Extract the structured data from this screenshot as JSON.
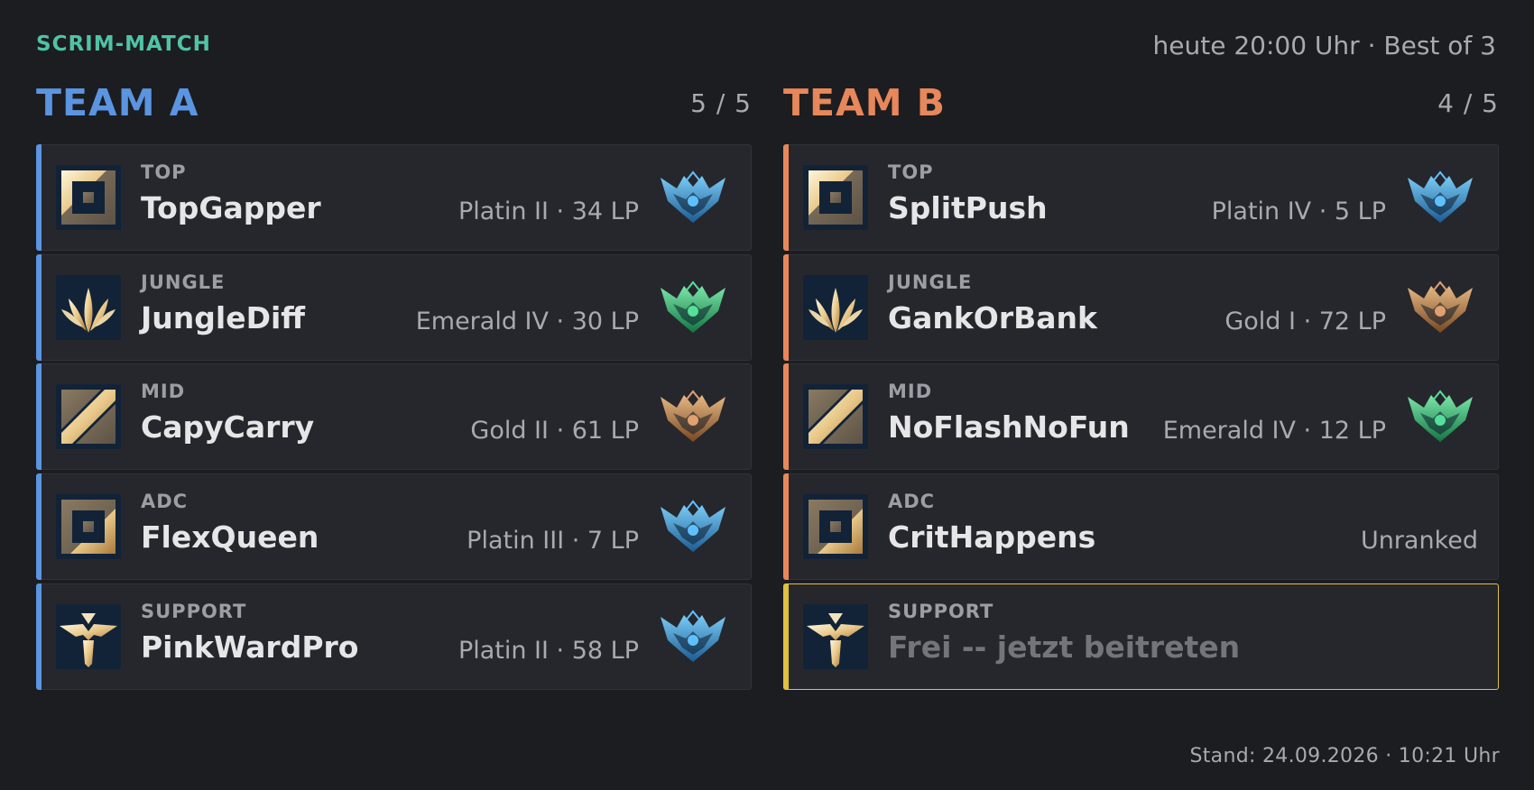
{
  "header": {
    "tag": "SCRIM-MATCH",
    "meta": "heute 20:00 Uhr  ·  Best of 3"
  },
  "team_a": {
    "name": "TEAM A",
    "count": "5 / 5",
    "color": "#5b94e0",
    "slots": [
      {
        "role": "TOP",
        "player": "TopGapper",
        "rank": "Platin II · 34 LP",
        "role_icon": "top-lane-icon",
        "crest": "platinum-crest-icon"
      },
      {
        "role": "JUNGLE",
        "player": "JungleDiff",
        "rank": "Emerald IV · 30 LP",
        "role_icon": "jungle-icon",
        "crest": "emerald-crest-icon"
      },
      {
        "role": "MID",
        "player": "CapyCarry",
        "rank": "Gold II · 61 LP",
        "role_icon": "mid-lane-icon",
        "crest": "gold-crest-icon"
      },
      {
        "role": "ADC",
        "player": "FlexQueen",
        "rank": "Platin III · 7 LP",
        "role_icon": "bottom-lane-icon",
        "crest": "platinum-crest-icon"
      },
      {
        "role": "SUPPORT",
        "player": "PinkWardPro",
        "rank": "Platin II · 58 LP",
        "role_icon": "support-icon",
        "crest": "platinum-crest-icon"
      }
    ]
  },
  "team_b": {
    "name": "TEAM B",
    "count": "4 / 5",
    "color": "#e8875a",
    "slots": [
      {
        "role": "TOP",
        "player": "SplitPush",
        "rank": "Platin IV · 5 LP",
        "role_icon": "top-lane-icon",
        "crest": "platinum-crest-icon"
      },
      {
        "role": "JUNGLE",
        "player": "GankOrBank",
        "rank": "Gold I · 72 LP",
        "role_icon": "jungle-icon",
        "crest": "gold-crest-icon"
      },
      {
        "role": "MID",
        "player": "NoFlashNoFun",
        "rank": "Emerald IV · 12 LP",
        "role_icon": "mid-lane-icon",
        "crest": "emerald-crest-icon"
      },
      {
        "role": "ADC",
        "player": "CritHappens",
        "rank": "Unranked",
        "role_icon": "bottom-lane-icon"
      },
      {
        "role": "SUPPORT",
        "player": "Frei -- jetzt beitreten",
        "role_icon": "support-icon",
        "open": true,
        "highlight": "#e0c040"
      }
    ]
  },
  "footer": "Stand: 24.09.2026 · 10:21 Uhr",
  "colors": {
    "accent_tag": "#4fc3a6",
    "platinum": "#3aa0e0",
    "emerald": "#2fbf6a",
    "gold": "#c07a3a"
  }
}
